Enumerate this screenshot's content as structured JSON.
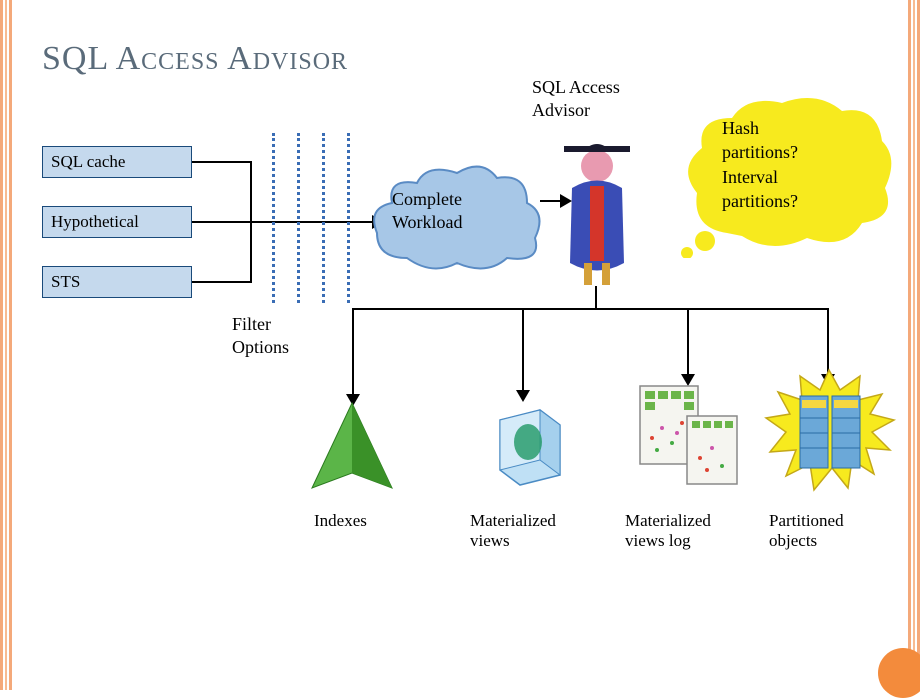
{
  "title": "SQL Access Advisor",
  "sources": {
    "sql_cache": "SQL cache",
    "hypothetical": "Hypothetical",
    "sts": "STS"
  },
  "filter_label": "Filter\nOptions",
  "cloud_label": "Complete\nWorkload",
  "advisor_label": "SQL Access\nAdvisor",
  "thought": "Hash\npartitions?\nInterval\npartitions?",
  "outputs": {
    "indexes": "Indexes",
    "mviews": "Materialized\nviews",
    "mviews_log": "Materialized\nviews log",
    "partitioned": "Partitioned\nobjects"
  }
}
